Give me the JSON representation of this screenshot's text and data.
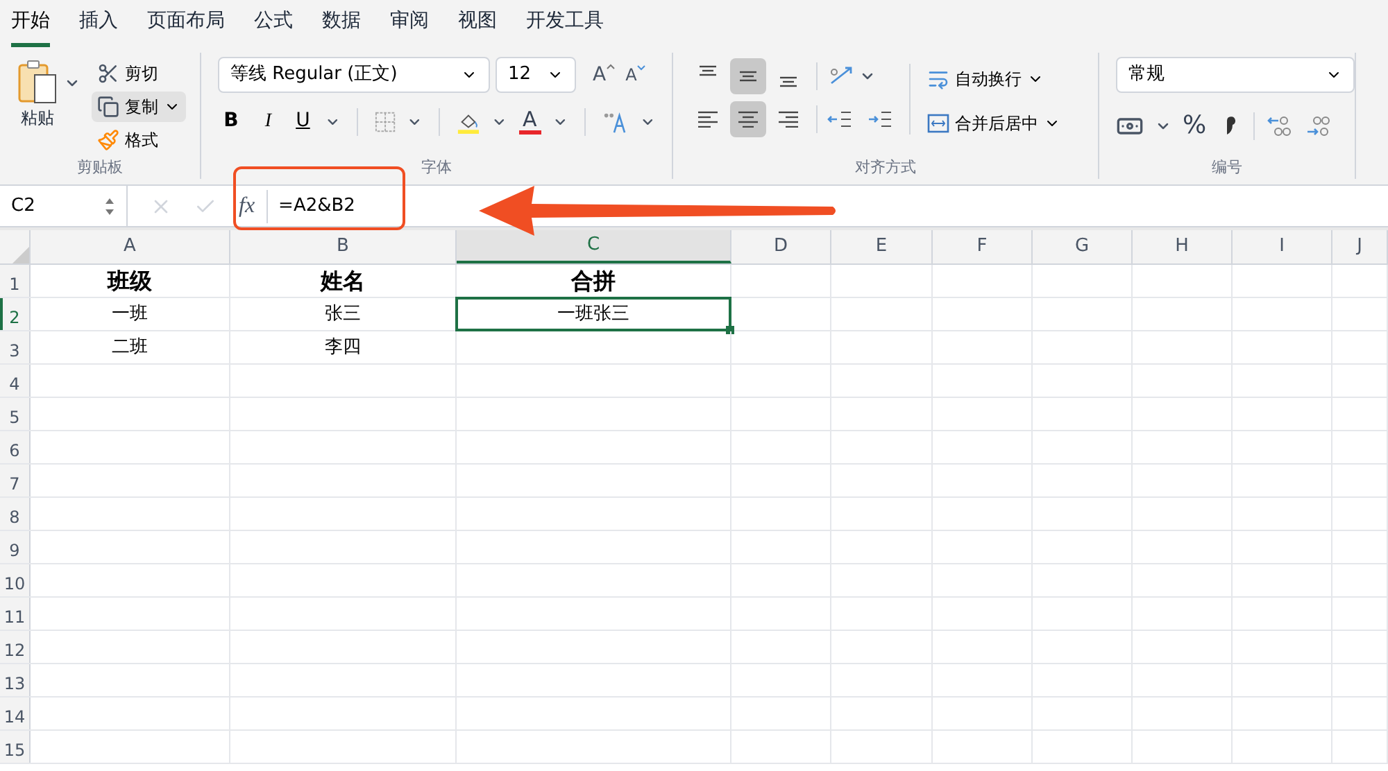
{
  "tabs": [
    {
      "label": "开始",
      "selected": true
    },
    {
      "label": "插入",
      "selected": false
    },
    {
      "label": "页面布局",
      "selected": false
    },
    {
      "label": "公式",
      "selected": false
    },
    {
      "label": "数据",
      "selected": false
    },
    {
      "label": "审阅",
      "selected": false
    },
    {
      "label": "视图",
      "selected": false
    },
    {
      "label": "开发工具",
      "selected": false
    }
  ],
  "clipboard": {
    "paste": "粘贴",
    "cut": "剪切",
    "copy": "复制",
    "format": "格式",
    "group_label": "剪贴板"
  },
  "font": {
    "name": "等线 Regular (正文)",
    "size": "12",
    "grow": "A",
    "shrink": "A",
    "bold": "B",
    "italic": "I",
    "underline": "U",
    "font_color": "A",
    "group_label": "字体"
  },
  "alignment": {
    "top_row": [
      {
        "kind": "top",
        "selected": false
      },
      {
        "kind": "middle",
        "selected": true
      },
      {
        "kind": "bottom",
        "selected": false
      }
    ],
    "bottom_row": [
      {
        "kind": "left",
        "selected": false
      },
      {
        "kind": "center",
        "selected": true
      },
      {
        "kind": "right",
        "selected": false
      }
    ],
    "wrap_text": "自动换行",
    "merge_center": "合并后居中",
    "group_label": "对齐方式"
  },
  "number": {
    "format": "常规",
    "percent": "%",
    "group_label": "编号"
  },
  "formula_bar": {
    "cell_ref": "C2",
    "fx": "fx",
    "formula": "=A2&B2"
  },
  "columns": [
    {
      "label": "A",
      "selected": false
    },
    {
      "label": "B",
      "selected": false
    },
    {
      "label": "C",
      "selected": true
    },
    {
      "label": "D",
      "selected": false
    },
    {
      "label": "E",
      "selected": false
    },
    {
      "label": "F",
      "selected": false
    },
    {
      "label": "G",
      "selected": false
    },
    {
      "label": "H",
      "selected": false
    },
    {
      "label": "I",
      "selected": false
    },
    {
      "label": "J",
      "selected": false
    }
  ],
  "rows": [
    {
      "label": "1",
      "selected": false,
      "cells": [
        {
          "text": "班级",
          "bold": true
        },
        {
          "text": "姓名",
          "bold": true
        },
        {
          "text": "合拼",
          "bold": true,
          "selected": false
        }
      ]
    },
    {
      "label": "2",
      "selected": true,
      "cells": [
        {
          "text": "一班",
          "bold": false
        },
        {
          "text": "张三",
          "bold": false
        },
        {
          "text": "一班张三",
          "bold": false,
          "selected": true
        }
      ]
    },
    {
      "label": "3",
      "selected": false,
      "cells": [
        {
          "text": "二班",
          "bold": false
        },
        {
          "text": "李四",
          "bold": false
        }
      ]
    },
    {
      "label": "4",
      "selected": false,
      "cells": []
    },
    {
      "label": "5",
      "selected": false,
      "cells": []
    },
    {
      "label": "6",
      "selected": false,
      "cells": []
    },
    {
      "label": "7",
      "selected": false,
      "cells": []
    },
    {
      "label": "8",
      "selected": false,
      "cells": []
    },
    {
      "label": "9",
      "selected": false,
      "cells": []
    },
    {
      "label": "10",
      "selected": false,
      "cells": []
    },
    {
      "label": "11",
      "selected": false,
      "cells": []
    },
    {
      "label": "12",
      "selected": false,
      "cells": []
    },
    {
      "label": "13",
      "selected": false,
      "cells": []
    },
    {
      "label": "14",
      "selected": false,
      "cells": []
    },
    {
      "label": "15",
      "selected": false,
      "cells": []
    }
  ]
}
